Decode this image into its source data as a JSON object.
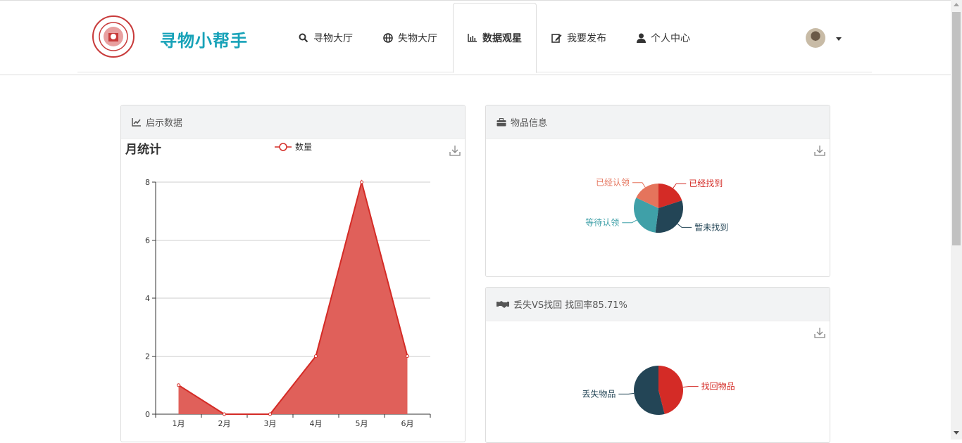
{
  "brand": {
    "title": "寻物小帮手"
  },
  "nav": {
    "items": [
      {
        "label": "寻物大厅",
        "icon": "search-icon"
      },
      {
        "label": "失物大厅",
        "icon": "globe-icon"
      },
      {
        "label": "数据观星",
        "icon": "bar-chart-icon",
        "active": true
      },
      {
        "label": "我要发布",
        "icon": "edit-icon"
      },
      {
        "label": "个人中心",
        "icon": "user-icon"
      }
    ]
  },
  "colors": {
    "brand": "#17a2b8",
    "area": "#e0605a",
    "line": "#d42b26",
    "slate": "#234556",
    "teal": "#3fa0a8",
    "salmon": "#e5745c"
  },
  "cards": {
    "notice": {
      "title": "启示数据",
      "icon": "line-chart-icon"
    },
    "items": {
      "title": "物品信息",
      "icon": "briefcase-icon"
    },
    "lostfound": {
      "title": "丢失VS找回 找回率85.71%",
      "icon": "handshake-icon"
    }
  },
  "chart_data": [
    {
      "type": "area",
      "title": "月统计",
      "legend": "数量",
      "categories": [
        "1月",
        "2月",
        "3月",
        "4月",
        "5月",
        "6月"
      ],
      "values": [
        1,
        0,
        0,
        2,
        8,
        2
      ],
      "ylim": [
        0,
        8
      ],
      "yticks": [
        0,
        2,
        4,
        6,
        8
      ],
      "grid": true
    },
    {
      "type": "pie",
      "slices": [
        {
          "name": "已经找到",
          "value": 20,
          "color": "#d42b26"
        },
        {
          "name": "暂未找到",
          "value": 32,
          "color": "#234556"
        },
        {
          "name": "等待认领",
          "value": 30,
          "color": "#3fa0a8"
        },
        {
          "name": "已经认领",
          "value": 18,
          "color": "#e5745c"
        }
      ]
    },
    {
      "type": "pie",
      "slices": [
        {
          "name": "找回物品",
          "value": 46,
          "color": "#d42b26"
        },
        {
          "name": "丢失物品",
          "value": 54,
          "color": "#234556"
        }
      ]
    }
  ]
}
